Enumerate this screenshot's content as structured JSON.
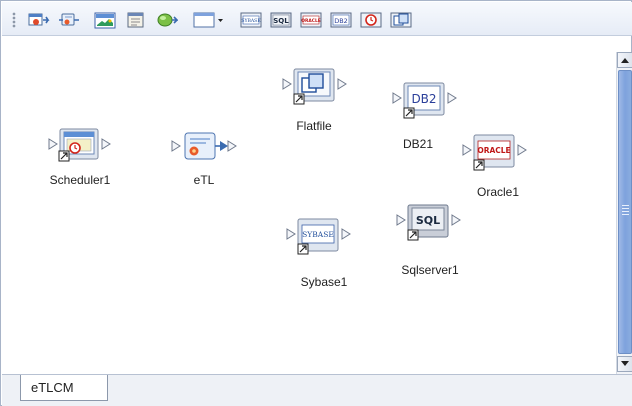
{
  "toolbar": {
    "buttons": [
      {
        "name": "scheduler-icon"
      },
      {
        "name": "etl-collaboration-icon"
      },
      {
        "name": "batch-icon"
      },
      {
        "name": "file-icon"
      },
      {
        "name": "database-connector-icon"
      },
      {
        "name": "window-dropdown-icon"
      },
      {
        "name": "sybase-icon",
        "text": "SYBASE"
      },
      {
        "name": "sql-icon",
        "text": "SQL"
      },
      {
        "name": "oracle-icon",
        "text": "ORACLE"
      },
      {
        "name": "db2-icon",
        "text": "DB2"
      },
      {
        "name": "schedule-target-icon"
      },
      {
        "name": "flatfile-icon"
      }
    ]
  },
  "nodes": [
    {
      "id": "scheduler",
      "label": "Scheduler1",
      "icon": "scheduler-icon"
    },
    {
      "id": "etl",
      "label": "eTL",
      "icon": "etl-collaboration-icon"
    },
    {
      "id": "flatfile",
      "label": "Flatfile",
      "icon": "flatfile-icon"
    },
    {
      "id": "db2",
      "label": "DB21",
      "icon": "db2-icon",
      "badge": "DB2"
    },
    {
      "id": "oracle",
      "label": "Oracle1",
      "icon": "oracle-icon",
      "badge": "ORACLE"
    },
    {
      "id": "sybase",
      "label": "Sybase1",
      "icon": "sybase-icon",
      "badge": "SYBASE"
    },
    {
      "id": "sqlserver",
      "label": "Sqlserver1",
      "icon": "sql-icon",
      "badge": "SQL"
    }
  ],
  "tabs": [
    {
      "label": "eTLCM",
      "selected": true
    }
  ]
}
